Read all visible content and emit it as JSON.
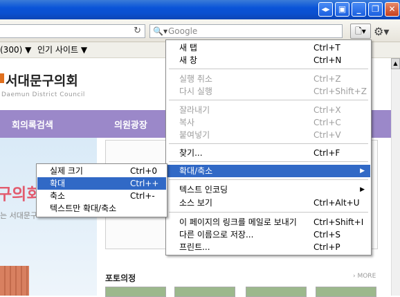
{
  "window": {
    "minimize": "_",
    "restore": "❐",
    "close": "✕"
  },
  "toolbar": {
    "search_placeholder": "Google",
    "search_icon": "search-icon",
    "reload_icon": "↻",
    "page_button": "🗋▾",
    "gear_button": "⚙▾"
  },
  "bookmarks": {
    "item1": "(300) ▼",
    "item2": "인기 사이트 ▼"
  },
  "page": {
    "logo": "서대문구의회",
    "logo_sub": "Daemun District Council",
    "nav1": "회의록검색",
    "nav2": "의원광장",
    "banner_title": "구의회",
    "banner_sub": "는 서대문구",
    "photo_title": "포토의정",
    "photo_more": "› MORE"
  },
  "page_menu": [
    {
      "label": "새 탭",
      "shortcut": "Ctrl+T",
      "disabled": false
    },
    {
      "label": "새 창",
      "shortcut": "Ctrl+N",
      "disabled": false
    },
    {
      "label": "실행 취소",
      "shortcut": "Ctrl+Z",
      "disabled": true
    },
    {
      "label": "다시 실행",
      "shortcut": "Ctrl+Shift+Z",
      "disabled": true
    },
    {
      "label": "잘라내기",
      "shortcut": "Ctrl+X",
      "disabled": true
    },
    {
      "label": "복사",
      "shortcut": "Ctrl+C",
      "disabled": true
    },
    {
      "label": "붙여넣기",
      "shortcut": "Ctrl+V",
      "disabled": true
    },
    {
      "label": "찾기...",
      "shortcut": "Ctrl+F",
      "disabled": false
    },
    {
      "label": "확대/축소",
      "shortcut": "",
      "submenu": true
    },
    {
      "label": "텍스트 인코딩",
      "shortcut": "",
      "submenu": true
    },
    {
      "label": "소스 보기",
      "shortcut": "Ctrl+Alt+U",
      "disabled": false
    },
    {
      "label": "이 페이지의 링크를 메일로 보내기",
      "shortcut": "Ctrl+Shift+I",
      "disabled": false
    },
    {
      "label": "다른 이름으로 저장...",
      "shortcut": "Ctrl+S",
      "disabled": false
    },
    {
      "label": "프린트...",
      "shortcut": "Ctrl+P",
      "disabled": false
    }
  ],
  "zoom_menu": [
    {
      "label": "실제 크기",
      "shortcut": "Ctrl+0"
    },
    {
      "label": "확대",
      "shortcut": "Ctrl++"
    },
    {
      "label": "축소",
      "shortcut": "Ctrl+-"
    },
    {
      "label": "텍스트만 확대/축소",
      "shortcut": ""
    }
  ]
}
